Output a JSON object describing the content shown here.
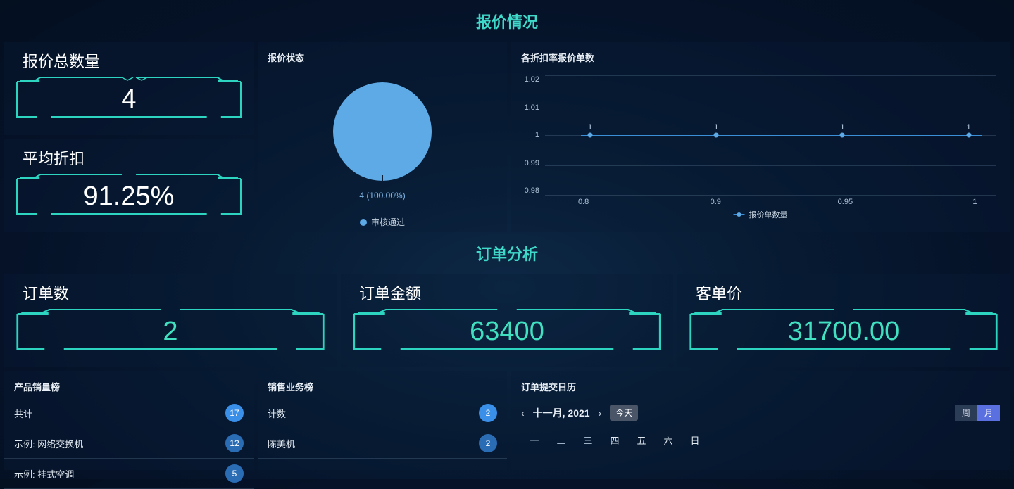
{
  "section1": {
    "title": "报价情况",
    "total_label": "报价总数量",
    "total_value": "4",
    "avg_label": "平均折扣",
    "avg_value": "91.25%",
    "pie": {
      "title": "报价状态",
      "label": "4 (100.00%)",
      "legend": "审核通过"
    },
    "line": {
      "title": "各折扣率报价单数",
      "legend": "报价单数量"
    }
  },
  "chart_data": [
    {
      "type": "pie",
      "title": "报价状态",
      "series": [
        {
          "name": "审核通过",
          "value": 4,
          "percent": 100.0
        }
      ]
    },
    {
      "type": "line",
      "title": "各折扣率报价单数",
      "xlabel": "",
      "ylabel": "",
      "x": [
        0.8,
        0.9,
        0.95,
        1
      ],
      "values": [
        1,
        1,
        1,
        1
      ],
      "ylim": [
        0.98,
        1.02
      ],
      "yticks": [
        0.98,
        0.99,
        1,
        1.01,
        1.02
      ],
      "series_name": "报价单数量"
    }
  ],
  "section2": {
    "title": "订单分析",
    "order_count_label": "订单数",
    "order_count_value": "2",
    "order_amount_label": "订单金额",
    "order_amount_value": "63400",
    "unit_price_label": "客单价",
    "unit_price_value": "31700.00"
  },
  "product_rank": {
    "title": "产品销量榜",
    "items": [
      {
        "label": "共计",
        "value": "17",
        "hl": true
      },
      {
        "label": "示例: 网络交换机",
        "value": "12",
        "hl": false
      },
      {
        "label": "示例: 挂式空调",
        "value": "5",
        "hl": false
      }
    ]
  },
  "sales_rank": {
    "title": "销售业务榜",
    "items": [
      {
        "label": "计数",
        "value": "2",
        "hl": true
      },
      {
        "label": "陈美机",
        "value": "2",
        "hl": false
      }
    ]
  },
  "calendar": {
    "title": "订单提交日历",
    "month": "十一月, 2021",
    "today": "今天",
    "week_btn": "周",
    "month_btn": "月",
    "days": [
      "一",
      "二",
      "三",
      "四",
      "五",
      "六",
      "日"
    ]
  }
}
